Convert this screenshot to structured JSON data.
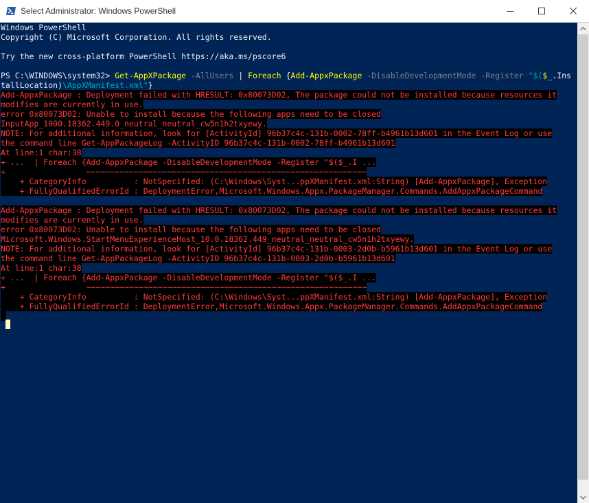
{
  "window": {
    "title": "Select Administrator: Windows PowerShell",
    "controls": [
      "minimize-icon",
      "maximize-icon",
      "close-icon"
    ]
  },
  "colors": {
    "console_bg": "#012456",
    "error_fg": "#ff3b3b",
    "error_bg": "#000000",
    "command": "#ffff00",
    "parameter": "#808080",
    "string": "#00aaaa"
  },
  "console": {
    "banner": [
      "Windows PowerShell",
      "Copyright (C) Microsoft Corporation. All rights reserved.",
      "Try the new cross-platform PowerShell https://aka.ms/pscore6"
    ],
    "prompt": "PS C:\\WINDOWS\\system32>",
    "command": {
      "t1": "Get-AppXPackage",
      "t2": " -AllUsers",
      "t3": " | ",
      "t4": "Foreach",
      "t5": " {",
      "t6": "Add-AppxPackage",
      "t7": " -DisableDevelopmentMode -Register ",
      "t8": "\"$(",
      "t9": "$_",
      "t10": ".Ins",
      "t11": "tallLocation)",
      "t12": "\\AppXManifest.xml\"",
      "t13": "}"
    },
    "errors": [
      {
        "lines": [
          "Add-AppxPackage : Deployment failed with HRESULT: 0x80073D02, The package could not be installed because resources it",
          "modifies are currently in use.",
          "error 0x80073D02: Unable to install because the following apps need to be closed",
          "InputApp_1000.18362.449.0_neutral_neutral_cw5n1h2txyewy.",
          "NOTE: For additional information, look for [ActivityId] 96b37c4c-131b-0002-78ff-b4961b13d601 in the Event Log or use",
          "the command line Get-AppPackageLog -ActivityID 96b37c4c-131b-0002-78ff-b4961b13d601",
          "At line:1 char:38",
          "+ ...  | Foreach {Add-AppxPackage -DisableDevelopmentMode -Register \"$($_.I ...",
          "+                 ~~~~~~~~~~~~~~~~~~~~~~~~~~~~~~~~~~~~~~~~~~~~~~~~~~~~~~~~~~~",
          "    + CategoryInfo          : NotSpecified: (C:\\Windows\\Syst...ppXManifest.xml:String) [Add-AppxPackage], Exception",
          "    + FullyQualifiedErrorId : DeploymentError,Microsoft.Windows.Appx.PackageManager.Commands.AddAppxPackageCommand"
        ]
      },
      {
        "lines": [
          "Add-AppxPackage : Deployment failed with HRESULT: 0x80073D02, The package could not be installed because resources it",
          "modifies are currently in use.",
          "error 0x80073D02: Unable to install because the following apps need to be closed",
          "Microsoft.Windows.StartMenuExperienceHost_10.0.18362.449_neutral_neutral_cw5n1h2txyewy.",
          "NOTE: For additional information, look for [ActivityId] 96b37c4c-131b-0003-2d0b-b5961b13d601 in the Event Log or use",
          "the command line Get-AppPackageLog -ActivityID 96b37c4c-131b-0003-2d0b-b5961b13d601",
          "At line:1 char:38",
          "+ ...  | Foreach {Add-AppxPackage -DisableDevelopmentMode -Register \"$($_.I ...",
          "+                 ~~~~~~~~~~~~~~~~~~~~~~~~~~~~~~~~~~~~~~~~~~~~~~~~~~~~~~~~~~~",
          "    + CategoryInfo          : NotSpecified: (C:\\Windows\\Syst...ppXManifest.xml:String) [Add-AppxPackage], Exception",
          "    + FullyQualifiedErrorId : DeploymentError,Microsoft.Windows.Appx.PackageManager.Commands.AddAppxPackageCommand"
        ]
      }
    ]
  }
}
